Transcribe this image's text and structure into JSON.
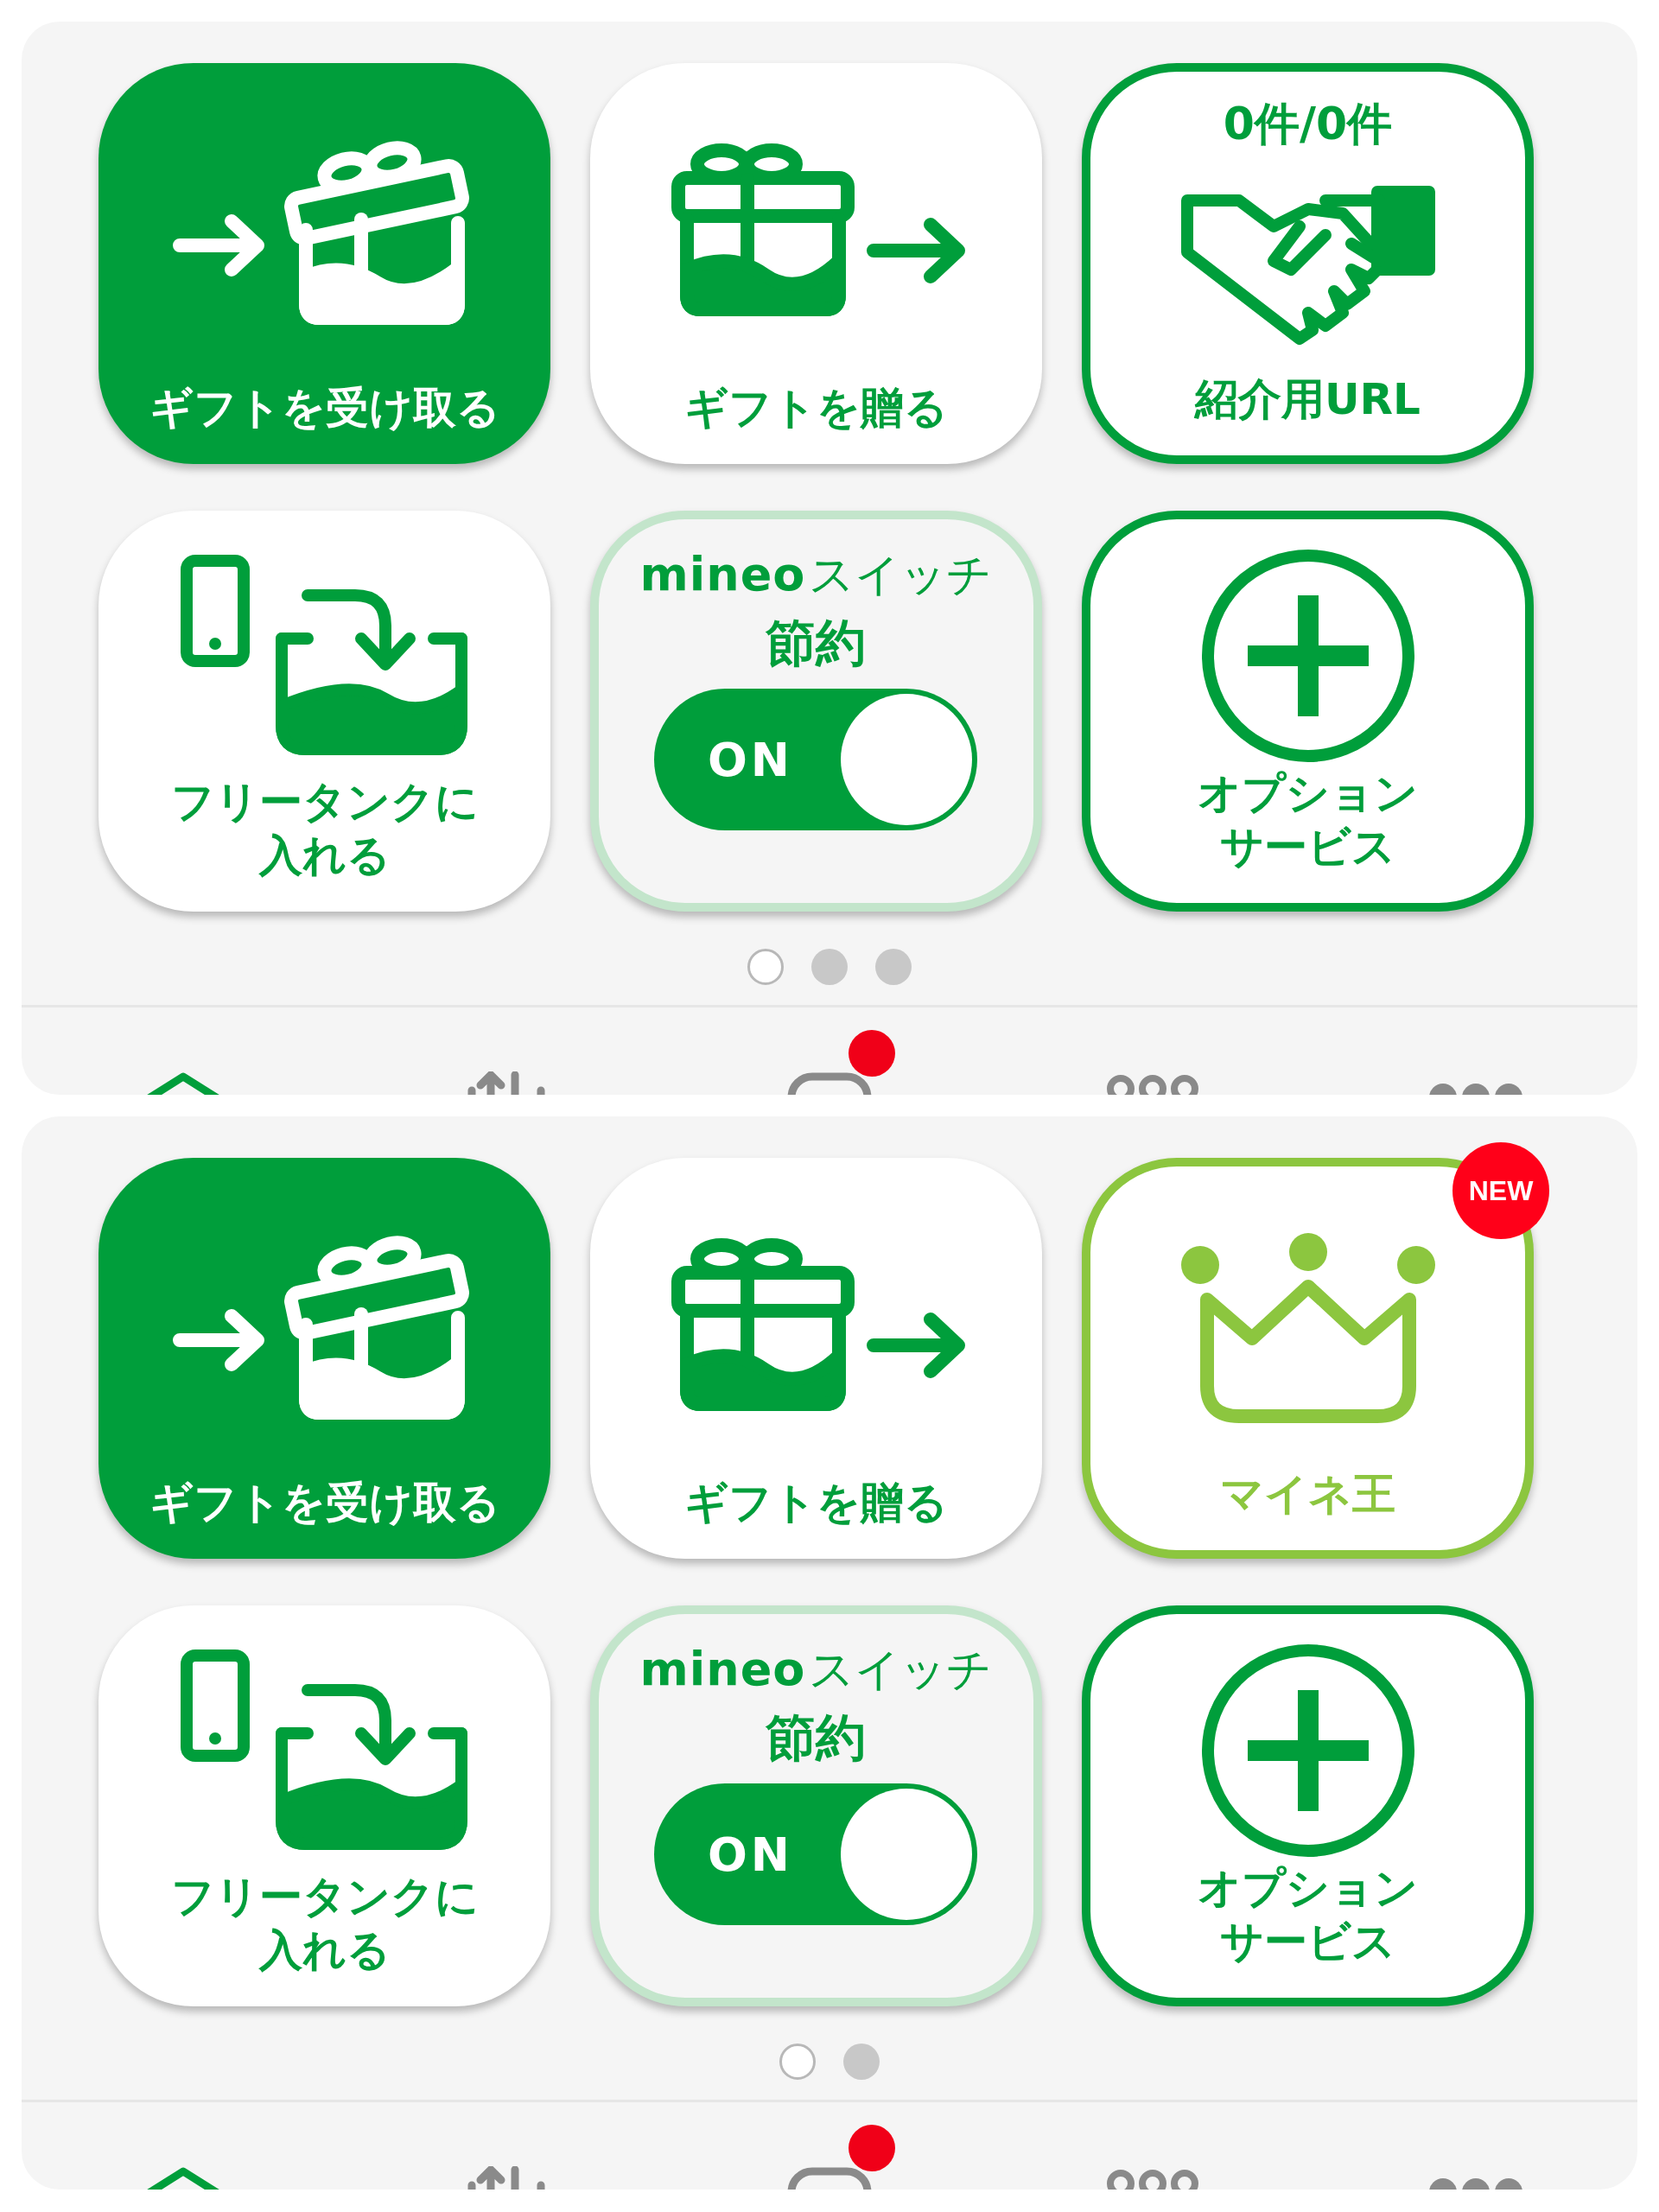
{
  "screens": [
    {
      "tiles": [
        {
          "kind": "receive_gift",
          "label": "ギフトを受け取る"
        },
        {
          "kind": "send_gift",
          "label": "ギフトを贈る"
        },
        {
          "kind": "referral",
          "count": "0件/0件",
          "label": "紹介用URL"
        },
        {
          "kind": "free_tank",
          "label": "フリータンクに入れる"
        },
        {
          "kind": "switch",
          "logo": "mineo",
          "label": "スイッチ",
          "subtitle": "節約",
          "switch": {
            "on": true,
            "label": "ON"
          }
        },
        {
          "kind": "option",
          "label": "オプションサービス"
        }
      ],
      "page_dots": [
        {
          "selected": true
        },
        {
          "selected": false
        },
        {
          "selected": false
        }
      ],
      "nav": [
        {
          "kind": "home",
          "selected": true,
          "badge": false
        },
        {
          "kind": "usage",
          "selected": false,
          "badge": false
        },
        {
          "kind": "chat",
          "selected": false,
          "badge": true
        },
        {
          "kind": "community",
          "selected": false,
          "badge": false
        },
        {
          "kind": "more",
          "selected": false,
          "badge": false
        }
      ]
    },
    {
      "tiles": [
        {
          "kind": "receive_gift",
          "label": "ギフトを受け取る"
        },
        {
          "kind": "send_gift",
          "label": "ギフトを贈る"
        },
        {
          "kind": "crown",
          "label": "マイネ王",
          "badge": "NEW"
        },
        {
          "kind": "free_tank",
          "label": "フリータンクに入れる"
        },
        {
          "kind": "switch",
          "logo": "mineo",
          "label": "スイッチ",
          "subtitle": "節約",
          "switch": {
            "on": true,
            "label": "ON"
          }
        },
        {
          "kind": "option",
          "label": "オプションサービス"
        }
      ],
      "page_dots": [
        {
          "selected": true
        },
        {
          "selected": false
        }
      ],
      "nav": [
        {
          "kind": "home",
          "selected": true,
          "badge": false
        },
        {
          "kind": "usage",
          "selected": false,
          "badge": false
        },
        {
          "kind": "chat",
          "selected": false,
          "badge": true
        },
        {
          "kind": "community",
          "selected": false,
          "badge": false
        },
        {
          "kind": "more",
          "selected": false,
          "badge": false
        }
      ]
    }
  ]
}
